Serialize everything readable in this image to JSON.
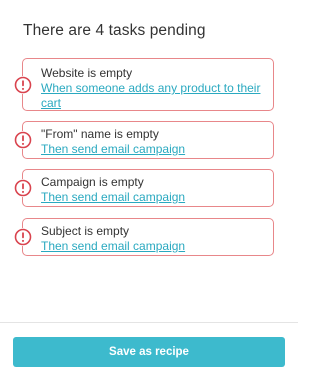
{
  "heading": "There are 4 tasks pending",
  "colors": {
    "warning": "#d9434e",
    "card_border": "#e8878a",
    "link": "#2aa9c0",
    "button_bg": "#3dbacd",
    "button_text": "#ffffff"
  },
  "tasks": [
    {
      "icon": "exclamation-circle-icon",
      "title": "Website is empty",
      "link": "When someone adds any product to their cart"
    },
    {
      "icon": "exclamation-circle-icon",
      "title": "\"From\" name is empty",
      "link": "Then send email campaign"
    },
    {
      "icon": "exclamation-circle-icon",
      "title": "Campaign is empty",
      "link": "Then send email campaign"
    },
    {
      "icon": "exclamation-circle-icon",
      "title": "Subject is empty",
      "link": "Then send email campaign"
    }
  ],
  "footer": {
    "save_label": "Save as recipe"
  }
}
